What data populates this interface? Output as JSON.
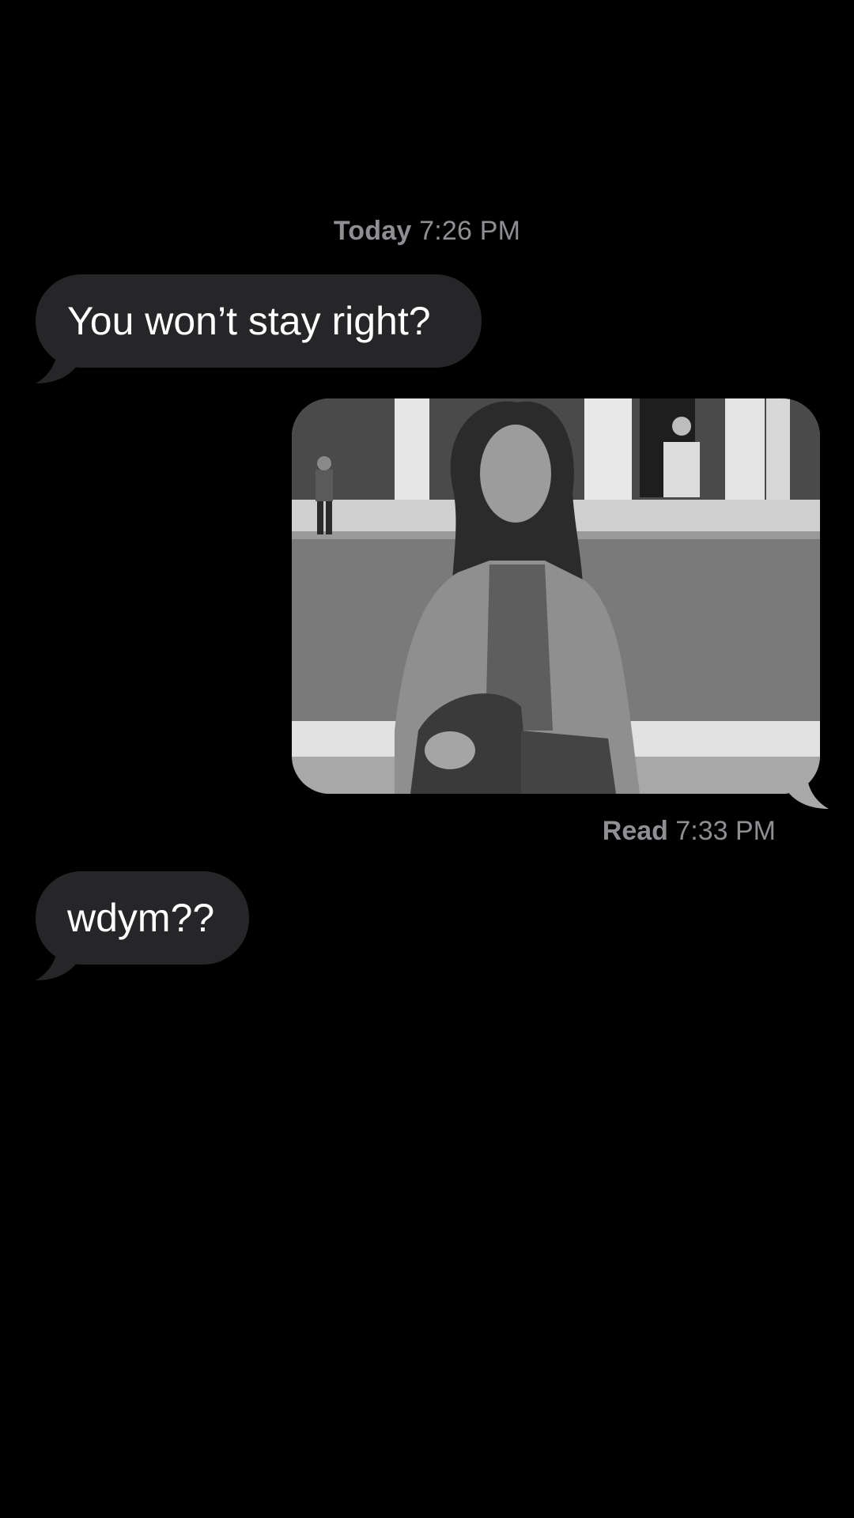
{
  "thread": {
    "date_label": "Today",
    "date_time": "7:26 PM",
    "messages": [
      {
        "direction": "incoming",
        "text": "You won’t stay right?"
      },
      {
        "direction": "outgoing",
        "type": "photo",
        "description": ""
      },
      {
        "direction": "incoming",
        "text": "wdym??"
      }
    ],
    "read_label": "Read",
    "read_time": "7:33 PM"
  },
  "colors": {
    "background": "#000000",
    "incoming_bubble": "#262628",
    "meta_text": "#8e8e93"
  }
}
